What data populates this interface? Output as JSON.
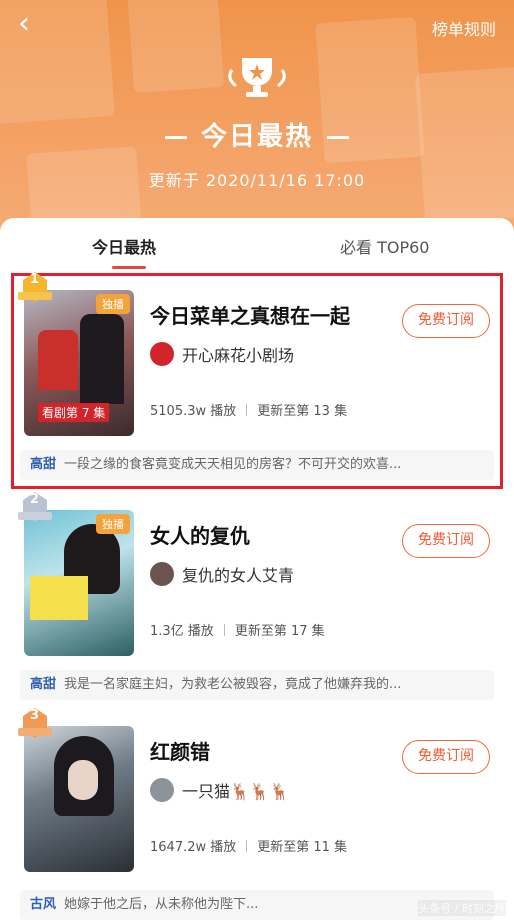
{
  "header": {
    "rules_label": "榜单规则",
    "title": "今日最热",
    "update_label": "更新于 2020/11/16 17:00"
  },
  "tabs": [
    {
      "label": "今日最热"
    },
    {
      "label": "必看 TOP60"
    }
  ],
  "subscribe_label": "免费订阅",
  "exclusive_label": "独播",
  "items": [
    {
      "rank": "1",
      "title": "今日菜单之真想在一起",
      "author": "开心麻花小剧场",
      "plays": "5105.3w 播放",
      "updated": "更新至第 13 集",
      "tag": "高甜",
      "desc": "一段之缘的食客竟变成天天相见的房客？不可开交的欢喜...",
      "poster_caption": "看剧第 7 集"
    },
    {
      "rank": "2",
      "title": "女人的复仇",
      "author": "复仇的女人艾青",
      "plays": "1.3亿 播放",
      "updated": "更新至第 17 集",
      "tag": "高甜",
      "desc": "我是一名家庭主妇，为救老公被毁容，竟成了他嫌弃我的...",
      "poster_caption": ""
    },
    {
      "rank": "3",
      "title": "红颜错",
      "author": "一只猫🦌🦌🦌",
      "plays": "1647.2w 播放",
      "updated": "更新至第 11 集",
      "tag": "古风",
      "desc": "她嫁于他之后，从未称他为陛下...",
      "poster_caption": ""
    }
  ],
  "watermark": "头条号 / 时刻之所",
  "colors": {
    "accent": "#ef5a30",
    "highlight_border": "#e5202e",
    "header_bg": "#f0944a"
  }
}
